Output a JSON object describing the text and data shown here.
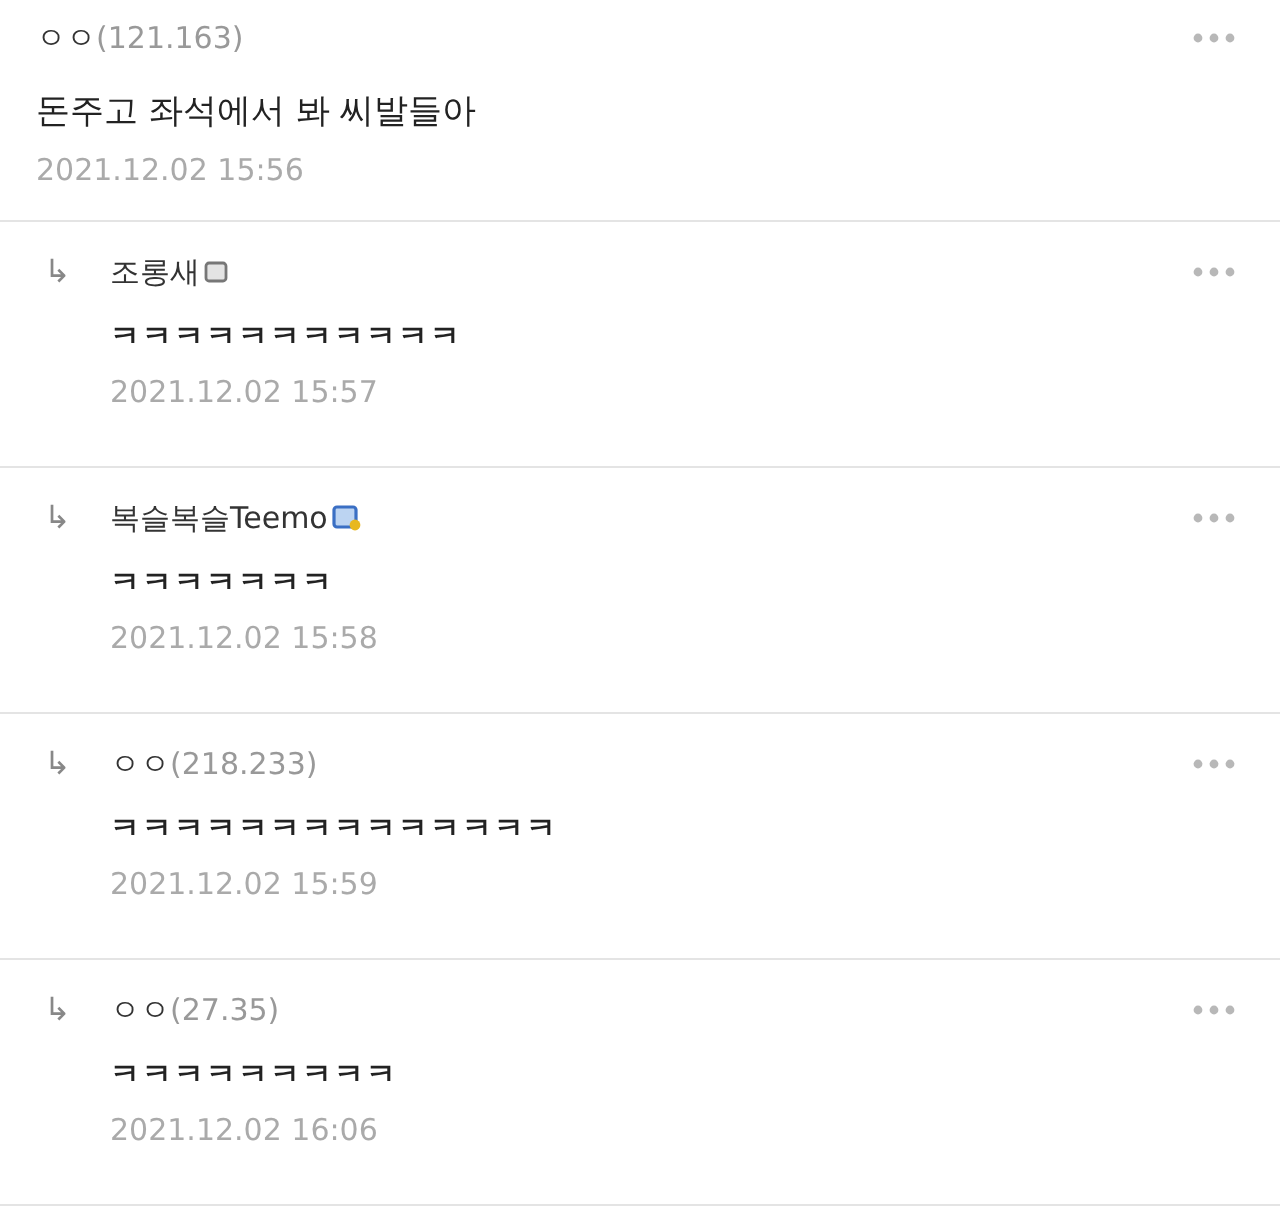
{
  "comment": {
    "name": "ㅇㅇ",
    "ip": "(121.163)",
    "text": "돈주고 좌석에서 봐 씨발들아",
    "date": "2021.12.02 15:56"
  },
  "replies": [
    {
      "kind": "fixed",
      "arrow": "↳",
      "name": "조롱새",
      "text": "ㅋㅋㅋㅋㅋㅋㅋㅋㅋㅋㅋ",
      "date": "2021.12.02 15:57"
    },
    {
      "kind": "semi",
      "arrow": "↳",
      "name": "복슬복슬Teemo",
      "text": "ㅋㅋㅋㅋㅋㅋㅋ",
      "date": "2021.12.02 15:58"
    },
    {
      "kind": "guest",
      "arrow": "↳",
      "name": "ㅇㅇ",
      "ip": "(218.233)",
      "text": "ㅋㅋㅋㅋㅋㅋㅋㅋㅋㅋㅋㅋㅋㅋ",
      "date": "2021.12.02 15:59"
    },
    {
      "kind": "guest",
      "arrow": "↳",
      "name": "ㅇㅇ",
      "ip": "(27.35)",
      "text": "ㅋㅋㅋㅋㅋㅋㅋㅋㅋ",
      "date": "2021.12.02 16:06"
    }
  ]
}
